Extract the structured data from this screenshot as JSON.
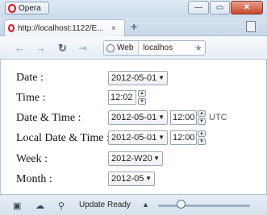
{
  "window": {
    "app_button": "Opera",
    "min_glyph": "—",
    "max_glyph": "▭",
    "close_glyph": "✕"
  },
  "tabs": [
    {
      "title": "http://localhost:1122/E...",
      "close_glyph": "×"
    }
  ],
  "tabbar": {
    "new_tab_glyph": "+"
  },
  "nav": {
    "back_glyph": "←",
    "forward_glyph": "→",
    "reload_glyph": "↻",
    "key_glyph": "⊸",
    "address_scope": "Web",
    "address_text": "localhos",
    "star_glyph": "★"
  },
  "form": {
    "date": {
      "label": "Date :",
      "value": "2012-05-01"
    },
    "time": {
      "label": "Time :",
      "value": "12:02"
    },
    "datetime": {
      "label": "Date & Time :",
      "date": "2012-05-01",
      "time": "12:00",
      "zone": "UTC"
    },
    "local_datetime": {
      "label": "Local Date & Time :",
      "date": "2012-05-01",
      "time": "12:00"
    },
    "week": {
      "label": "Week :",
      "value": "2012-W20"
    },
    "month": {
      "label": "Month :",
      "value": "2012-05"
    }
  },
  "statusbar": {
    "panel_glyph": "▣",
    "cloud_glyph": "☁",
    "share_glyph": "⚲",
    "text": "Update Ready",
    "caret_glyph": "▲"
  },
  "zoom_fraction": 0.25
}
